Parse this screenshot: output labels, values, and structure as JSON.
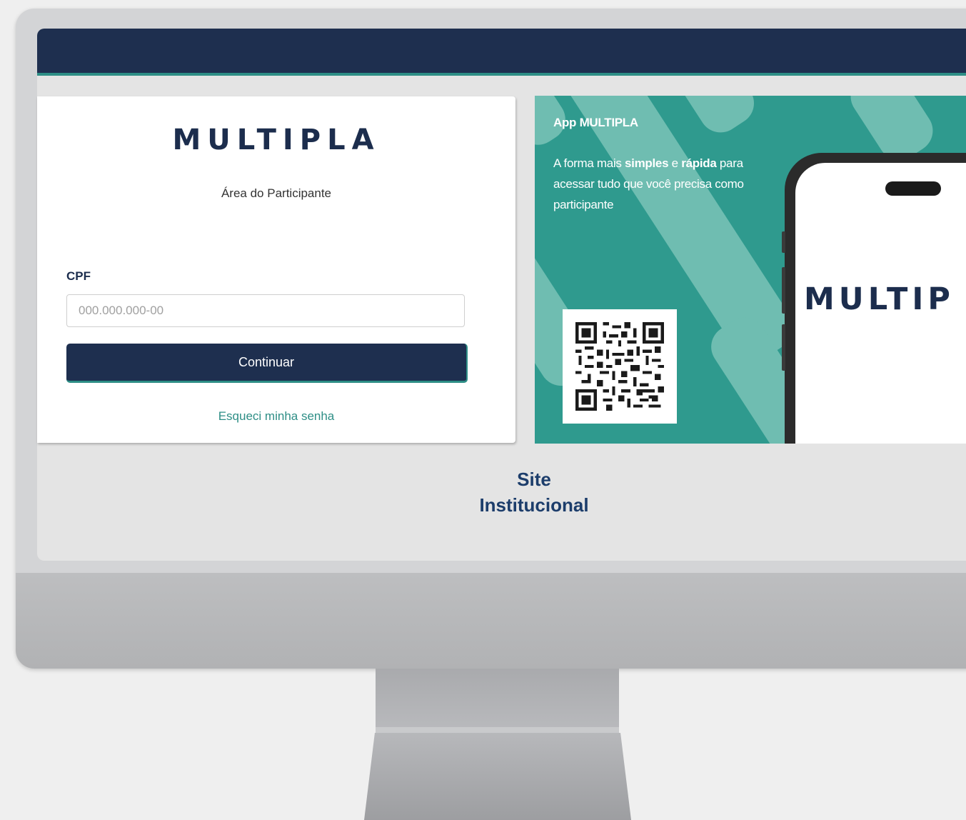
{
  "login": {
    "logo_text": "MULTIPLA",
    "subtitle": "Área do Participante",
    "cpf_label": "CPF",
    "cpf_placeholder": "000.000.000-00",
    "cpf_value": "",
    "continue_label": "Continuar",
    "forgot_label": "Esqueci minha senha"
  },
  "promo": {
    "title": "App MULTIPLA",
    "text_part1": "A forma mais ",
    "text_bold1": "simples",
    "text_part2": " e ",
    "text_bold2": "rápida",
    "text_part3": " para acessar tudo que você precisa como participante",
    "phone_logo_text": "MULTIP"
  },
  "footer": {
    "site_line1": "Site",
    "site_line2": "Institucional"
  },
  "colors": {
    "navy": "#1e2f4f",
    "teal": "#2e8e86",
    "promo_bg": "#2f9a8e"
  }
}
